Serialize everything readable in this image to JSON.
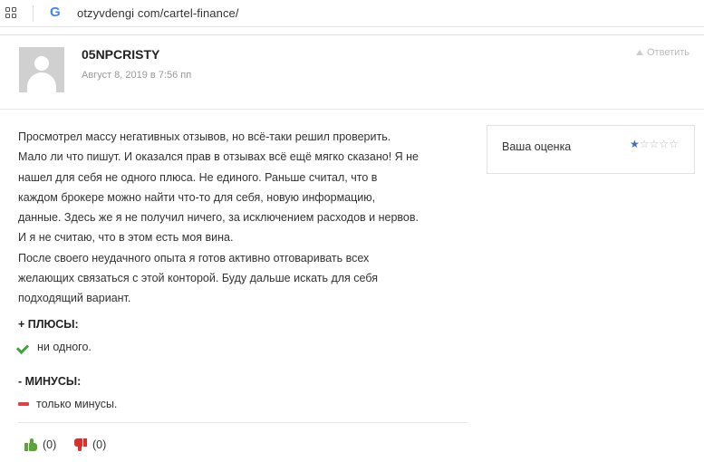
{
  "browser": {
    "url": "otzyvdengi com/cartel-finance/"
  },
  "review": {
    "author": "05NPCRISTY",
    "date": "Август 8, 2019 в 7:56 пп",
    "reply_label": "Ответить",
    "text_lines": [
      "Просмотрел массу негативных отзывов, но всё-таки решил проверить.",
      "Мало ли что пишут. И оказался прав в отзывах всё ещё мягко сказано! Я не",
      "нашел для себя не одного плюса. Не единого. Раньше считал, что в",
      "каждом брокере можно найти что-то для себя, новую информацию,",
      "данные. Здесь же я не получил ничего, за исключением расходов и нервов.",
      "И я не считаю, что в этом есть моя вина.",
      "После своего неудачного опыта я готов активно отговаривать всех",
      "желающих связаться с этой конторой. Буду дальше искать для себя",
      "подходящий вариант."
    ],
    "rating": {
      "label": "Ваша оценка",
      "value": 1,
      "max": 5,
      "star_color": "#3d6fb8"
    },
    "pros": {
      "title": "+ ПЛЮСЫ:",
      "items": [
        "ни одного."
      ],
      "icon": "check-icon",
      "color": "#3fa43f"
    },
    "cons": {
      "title": "- МИНУСЫ:",
      "items": [
        "только минусы."
      ],
      "icon": "minus-icon",
      "color": "#e04040"
    },
    "votes": {
      "likes": "(0)",
      "dislikes": "(0)"
    }
  }
}
